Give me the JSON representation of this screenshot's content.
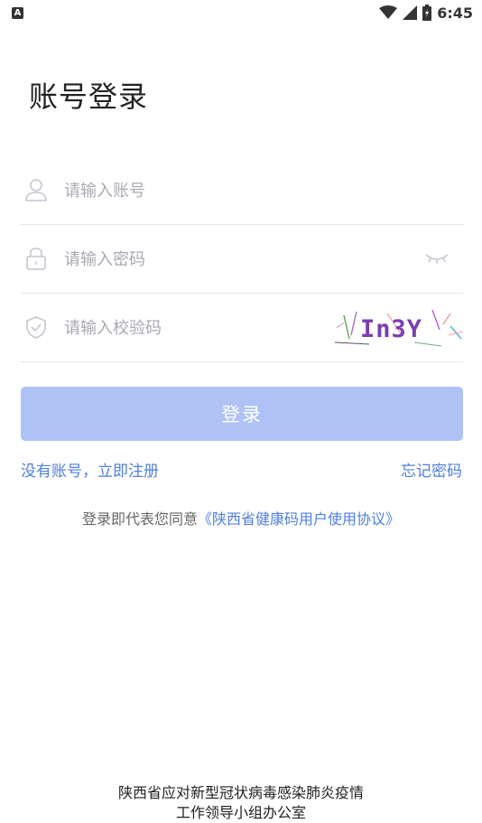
{
  "status_bar": {
    "notification_icon": "A",
    "time": "6:45"
  },
  "page": {
    "title": "账号登录"
  },
  "form": {
    "account_placeholder": "请输入账号",
    "password_placeholder": "请输入密码",
    "captcha_placeholder": "请输入校验码",
    "captcha_text": "In3Y"
  },
  "actions": {
    "login_label": "登录",
    "no_account_text": "没有账号，",
    "register_label": "立即注册",
    "forgot_label": "忘记密码"
  },
  "agreement": {
    "prefix": "登录即代表您同意",
    "link": "《陕西省健康码用户使用协议》"
  },
  "footer": {
    "line1": "陕西省应对新型冠状病毒感染肺炎疫情",
    "line2": "工作领导小组办公室"
  },
  "colors": {
    "accent": "#4d7fe0",
    "button_disabled": "#aec2f6",
    "divider": "#e6e6ea",
    "placeholder": "#a8a8b4"
  },
  "icons": [
    "person-icon",
    "lock-icon",
    "shield-check-icon",
    "eye-closed-icon",
    "wifi-icon",
    "cell-signal-icon",
    "battery-icon"
  ]
}
